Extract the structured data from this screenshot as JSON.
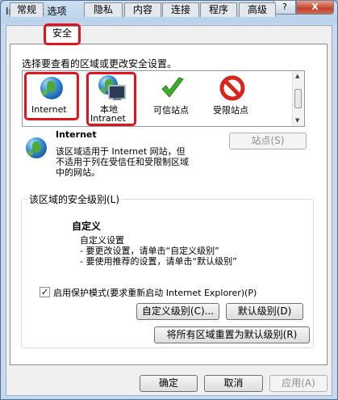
{
  "window": {
    "title": "Internet 选项",
    "help_label": "?",
    "close_label": "X"
  },
  "tabs": [
    {
      "label": "常规"
    },
    {
      "label": "安全"
    },
    {
      "label": "隐私"
    },
    {
      "label": "内容"
    },
    {
      "label": "连接"
    },
    {
      "label": "程序"
    },
    {
      "label": "高级"
    }
  ],
  "active_tab": "安全",
  "zones_section": {
    "instruction": "选择要查看的区域或更改安全设置。",
    "zones": [
      {
        "label": "Internet",
        "icon": "globe-icon"
      },
      {
        "label_line1": "本地",
        "label_line2": "Intranet",
        "icon": "intranet-icon"
      },
      {
        "label": "可信站点",
        "icon": "checkmark-icon"
      },
      {
        "label": "受限站点",
        "icon": "restricted-icon"
      }
    ]
  },
  "zone_info": {
    "name": "Internet",
    "desc_line1": "该区域适用于 Internet 网站，但",
    "desc_line2": "不适用于列在受信任和受限制区域",
    "desc_line3": "中的网站。",
    "sites_button": "站点(S)"
  },
  "security_level": {
    "group_label": "该区域的安全级别(L)",
    "level_name": "自定义",
    "line1": "自定义设置",
    "line2": "- 要更改设置，请单击“自定义级别”",
    "line3": "- 要使用推荐的设置，请单击“默认级别”",
    "protected_mode_label": "启用保护模式(要求重新启动 Internet Explorer)(P)",
    "protected_mode_checked": true,
    "custom_level_button": "自定义级别(C)...",
    "default_level_button": "默认级别(D)",
    "reset_all_button": "将所有区域重置为默认级别(R)"
  },
  "footer": {
    "ok": "确定",
    "cancel": "取消",
    "apply": "应用(A)"
  },
  "colors": {
    "highlight_border": "#e0141e"
  }
}
